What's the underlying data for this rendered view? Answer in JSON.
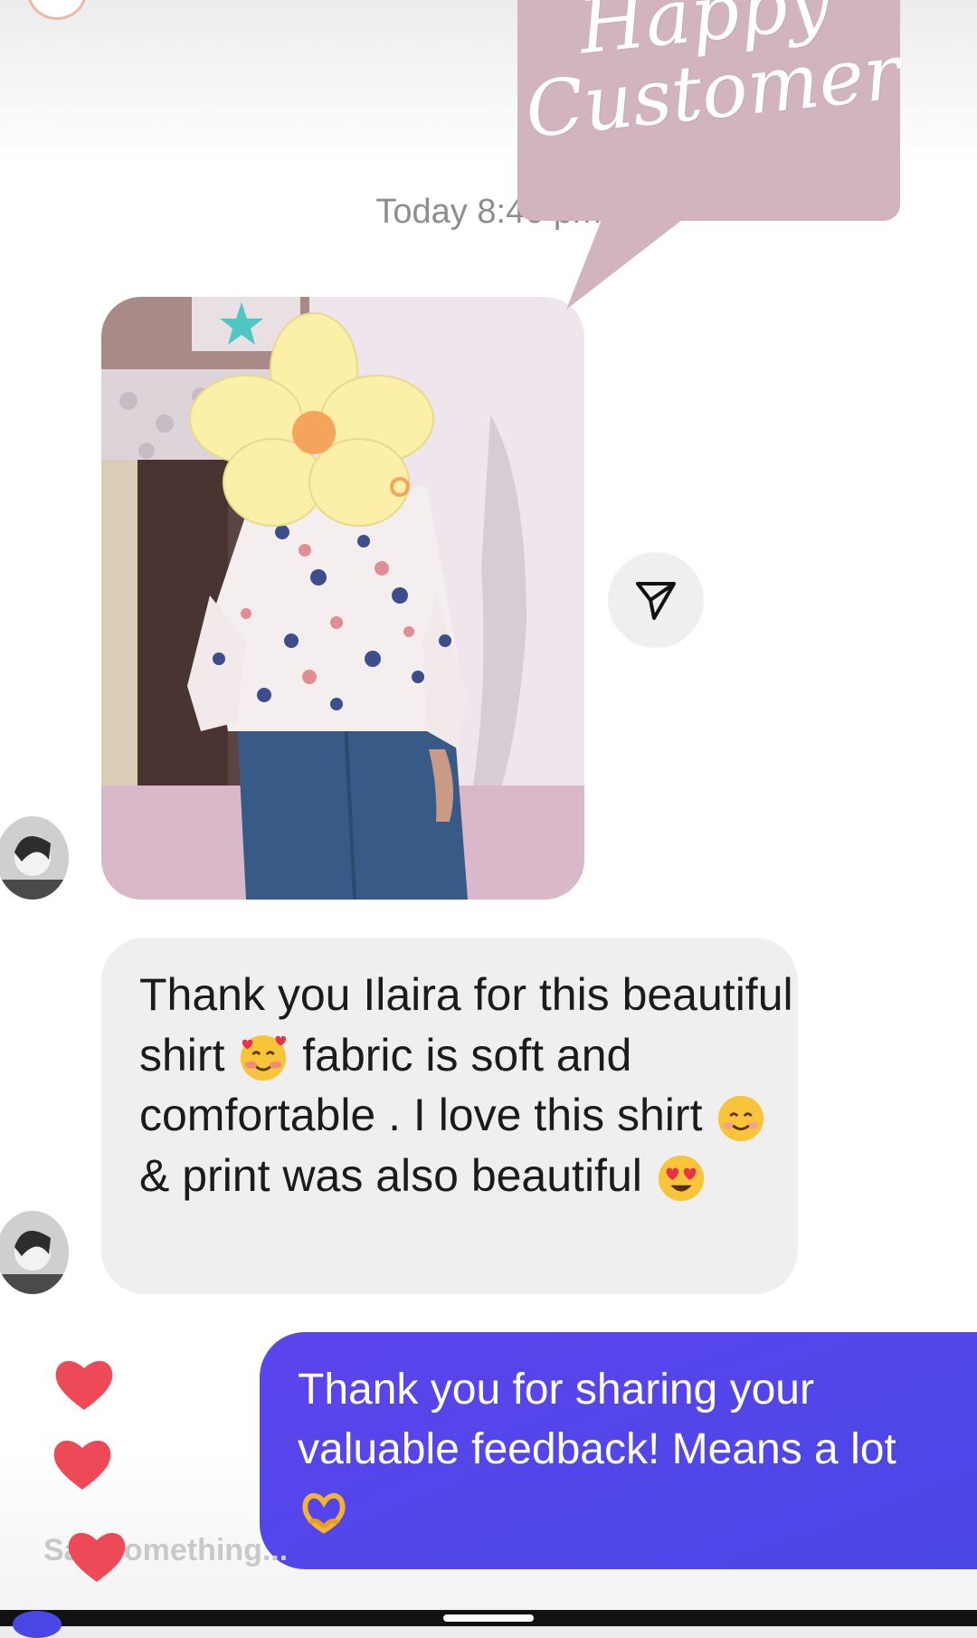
{
  "thread": {
    "timestamp": "Today 8:46 pm"
  },
  "sticker": {
    "line1": "Happy",
    "line2": "Customer",
    "color": "#d1b4bf"
  },
  "messages": {
    "received_text_parts": [
      "Thank you Ilaira for this beautiful  shirt ",
      " fabric is soft and comfortable . I love this shirt ",
      " & print was also beautiful "
    ],
    "received_emojis": [
      "smiling-face-with-hearts-emoji",
      "smiling-face-emoji",
      "heart-eyes-emoji"
    ],
    "sent_text": "Thank you for sharing your valuable feedback! Means a lot ",
    "sent_emoji": "heart-hands-emoji",
    "sent_bubble_color": "#5b45ec"
  },
  "composer": {
    "placeholder": "Say something..."
  },
  "icons": {
    "share": "send-paper-plane-icon",
    "reaction": "heart-icon",
    "reaction_color": "#ed4956"
  }
}
